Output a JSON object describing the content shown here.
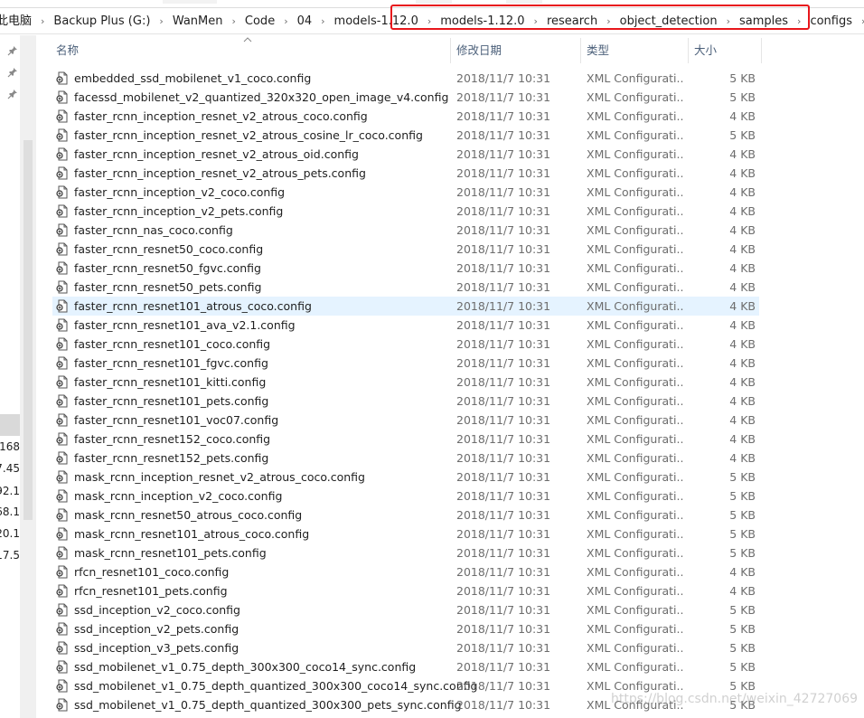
{
  "address_bar": {
    "crumbs": [
      "此电脑",
      "Backup Plus (G:)",
      "WanMen",
      "Code",
      "04",
      "models-1.12.0",
      "models-1.12.0",
      "research",
      "object_detection",
      "samples",
      "configs"
    ]
  },
  "highlight_color": "#e8161b",
  "nav_pane": {
    "pins": [
      "pin-icon",
      "pin-icon",
      "pin-icon"
    ],
    "truncated_items": [
      "168.",
      "7.45",
      "92.1",
      "68.1",
      "20.1",
      "17.5"
    ]
  },
  "columns": {
    "name": "名称",
    "date": "修改日期",
    "type": "类型",
    "size": "大小"
  },
  "files": [
    {
      "name": "embedded_ssd_mobilenet_v1_coco.config",
      "date": "2018/11/7 10:31",
      "type": "XML Configurati...",
      "size": "5 KB"
    },
    {
      "name": "facessd_mobilenet_v2_quantized_320x320_open_image_v4.config",
      "date": "2018/11/7 10:31",
      "type": "XML Configurati...",
      "size": "5 KB"
    },
    {
      "name": "faster_rcnn_inception_resnet_v2_atrous_coco.config",
      "date": "2018/11/7 10:31",
      "type": "XML Configurati...",
      "size": "4 KB"
    },
    {
      "name": "faster_rcnn_inception_resnet_v2_atrous_cosine_lr_coco.config",
      "date": "2018/11/7 10:31",
      "type": "XML Configurati...",
      "size": "5 KB"
    },
    {
      "name": "faster_rcnn_inception_resnet_v2_atrous_oid.config",
      "date": "2018/11/7 10:31",
      "type": "XML Configurati...",
      "size": "4 KB"
    },
    {
      "name": "faster_rcnn_inception_resnet_v2_atrous_pets.config",
      "date": "2018/11/7 10:31",
      "type": "XML Configurati...",
      "size": "4 KB"
    },
    {
      "name": "faster_rcnn_inception_v2_coco.config",
      "date": "2018/11/7 10:31",
      "type": "XML Configurati...",
      "size": "4 KB"
    },
    {
      "name": "faster_rcnn_inception_v2_pets.config",
      "date": "2018/11/7 10:31",
      "type": "XML Configurati...",
      "size": "4 KB"
    },
    {
      "name": "faster_rcnn_nas_coco.config",
      "date": "2018/11/7 10:31",
      "type": "XML Configurati...",
      "size": "4 KB"
    },
    {
      "name": "faster_rcnn_resnet50_coco.config",
      "date": "2018/11/7 10:31",
      "type": "XML Configurati...",
      "size": "4 KB"
    },
    {
      "name": "faster_rcnn_resnet50_fgvc.config",
      "date": "2018/11/7 10:31",
      "type": "XML Configurati...",
      "size": "4 KB"
    },
    {
      "name": "faster_rcnn_resnet50_pets.config",
      "date": "2018/11/7 10:31",
      "type": "XML Configurati...",
      "size": "4 KB"
    },
    {
      "name": "faster_rcnn_resnet101_atrous_coco.config",
      "date": "2018/11/7 10:31",
      "type": "XML Configurati...",
      "size": "4 KB",
      "selected": true
    },
    {
      "name": "faster_rcnn_resnet101_ava_v2.1.config",
      "date": "2018/11/7 10:31",
      "type": "XML Configurati...",
      "size": "4 KB"
    },
    {
      "name": "faster_rcnn_resnet101_coco.config",
      "date": "2018/11/7 10:31",
      "type": "XML Configurati...",
      "size": "4 KB"
    },
    {
      "name": "faster_rcnn_resnet101_fgvc.config",
      "date": "2018/11/7 10:31",
      "type": "XML Configurati...",
      "size": "4 KB"
    },
    {
      "name": "faster_rcnn_resnet101_kitti.config",
      "date": "2018/11/7 10:31",
      "type": "XML Configurati...",
      "size": "4 KB"
    },
    {
      "name": "faster_rcnn_resnet101_pets.config",
      "date": "2018/11/7 10:31",
      "type": "XML Configurati...",
      "size": "4 KB"
    },
    {
      "name": "faster_rcnn_resnet101_voc07.config",
      "date": "2018/11/7 10:31",
      "type": "XML Configurati...",
      "size": "4 KB"
    },
    {
      "name": "faster_rcnn_resnet152_coco.config",
      "date": "2018/11/7 10:31",
      "type": "XML Configurati...",
      "size": "4 KB"
    },
    {
      "name": "faster_rcnn_resnet152_pets.config",
      "date": "2018/11/7 10:31",
      "type": "XML Configurati...",
      "size": "4 KB"
    },
    {
      "name": "mask_rcnn_inception_resnet_v2_atrous_coco.config",
      "date": "2018/11/7 10:31",
      "type": "XML Configurati...",
      "size": "5 KB"
    },
    {
      "name": "mask_rcnn_inception_v2_coco.config",
      "date": "2018/11/7 10:31",
      "type": "XML Configurati...",
      "size": "5 KB"
    },
    {
      "name": "mask_rcnn_resnet50_atrous_coco.config",
      "date": "2018/11/7 10:31",
      "type": "XML Configurati...",
      "size": "5 KB"
    },
    {
      "name": "mask_rcnn_resnet101_atrous_coco.config",
      "date": "2018/11/7 10:31",
      "type": "XML Configurati...",
      "size": "5 KB"
    },
    {
      "name": "mask_rcnn_resnet101_pets.config",
      "date": "2018/11/7 10:31",
      "type": "XML Configurati...",
      "size": "5 KB"
    },
    {
      "name": "rfcn_resnet101_coco.config",
      "date": "2018/11/7 10:31",
      "type": "XML Configurati...",
      "size": "4 KB"
    },
    {
      "name": "rfcn_resnet101_pets.config",
      "date": "2018/11/7 10:31",
      "type": "XML Configurati...",
      "size": "4 KB"
    },
    {
      "name": "ssd_inception_v2_coco.config",
      "date": "2018/11/7 10:31",
      "type": "XML Configurati...",
      "size": "5 KB"
    },
    {
      "name": "ssd_inception_v2_pets.config",
      "date": "2018/11/7 10:31",
      "type": "XML Configurati...",
      "size": "5 KB"
    },
    {
      "name": "ssd_inception_v3_pets.config",
      "date": "2018/11/7 10:31",
      "type": "XML Configurati...",
      "size": "5 KB"
    },
    {
      "name": "ssd_mobilenet_v1_0.75_depth_300x300_coco14_sync.config",
      "date": "2018/11/7 10:31",
      "type": "XML Configurati...",
      "size": "5 KB"
    },
    {
      "name": "ssd_mobilenet_v1_0.75_depth_quantized_300x300_coco14_sync.config",
      "date": "2018/11/7 10:31",
      "type": "XML Configurati...",
      "size": "5 KB"
    },
    {
      "name": "ssd_mobilenet_v1_0.75_depth_quantized_300x300_pets_sync.config",
      "date": "2018/11/7 10:31",
      "type": "XML Configurati...",
      "size": "5 KB"
    }
  ],
  "watermark": "https://blog.csdn.net/weixin_42727069",
  "file_icon": "config-file-icon"
}
